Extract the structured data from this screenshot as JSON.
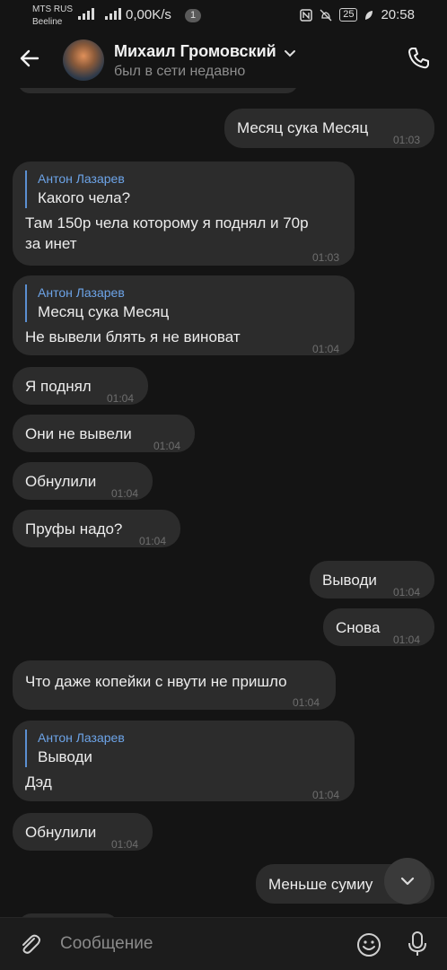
{
  "status_bar": {
    "carrier_1": "MTS RUS",
    "carrier_2": "Beeline",
    "network_speed": "0,00K/s",
    "sim_badge": "1",
    "battery": "25",
    "time": "20:58"
  },
  "header": {
    "contact_name": "Михаил Громовский",
    "contact_status": "был в сети недавно"
  },
  "messages": [
    {
      "direction": "outgoing",
      "text": "Месяц сука Месяц",
      "time": "01:03"
    },
    {
      "direction": "incoming",
      "reply_author": "Антон Лазарев",
      "reply_text": "Какого чела?",
      "text_line1": "Там 150р чела которому я поднял и 70р",
      "text_line2": "за инет",
      "time": "01:03"
    },
    {
      "direction": "incoming",
      "reply_author": "Антон Лазарев",
      "reply_text": "Месяц сука Месяц",
      "text": "Не вывели блять я не виноват",
      "time": "01:04"
    },
    {
      "direction": "incoming",
      "text": "Я поднял",
      "time": "01:04"
    },
    {
      "direction": "incoming",
      "text": "Они не вывели",
      "time": "01:04"
    },
    {
      "direction": "incoming",
      "text": "Обнулили",
      "time": "01:04"
    },
    {
      "direction": "incoming",
      "text": "Пруфы надо?",
      "time": "01:04"
    },
    {
      "direction": "outgoing",
      "text": "Выводи",
      "time": "01:04"
    },
    {
      "direction": "outgoing",
      "text": "Снова",
      "time": "01:04"
    },
    {
      "direction": "incoming",
      "text": "Что даже копейки с нвути не пришло",
      "time": "01:04"
    },
    {
      "direction": "incoming",
      "reply_author": "Антон Лазарев",
      "reply_text": "Выводи",
      "text": "Дэд",
      "time": "01:04"
    },
    {
      "direction": "incoming",
      "text": "Обнулили",
      "time": "01:04"
    },
    {
      "direction": "outgoing",
      "text": "Меньше сумиу",
      "time": ""
    }
  ],
  "composer": {
    "placeholder": "Сообщение"
  },
  "icons": [
    "back-arrow-icon",
    "chevron-down-icon",
    "phone-icon",
    "scroll-down-icon",
    "paperclip-icon",
    "emoji-icon",
    "microphone-icon"
  ],
  "colors": {
    "background": "#141414",
    "bubble": "#2c2c2c",
    "reply_accent": "#6da4e8"
  }
}
